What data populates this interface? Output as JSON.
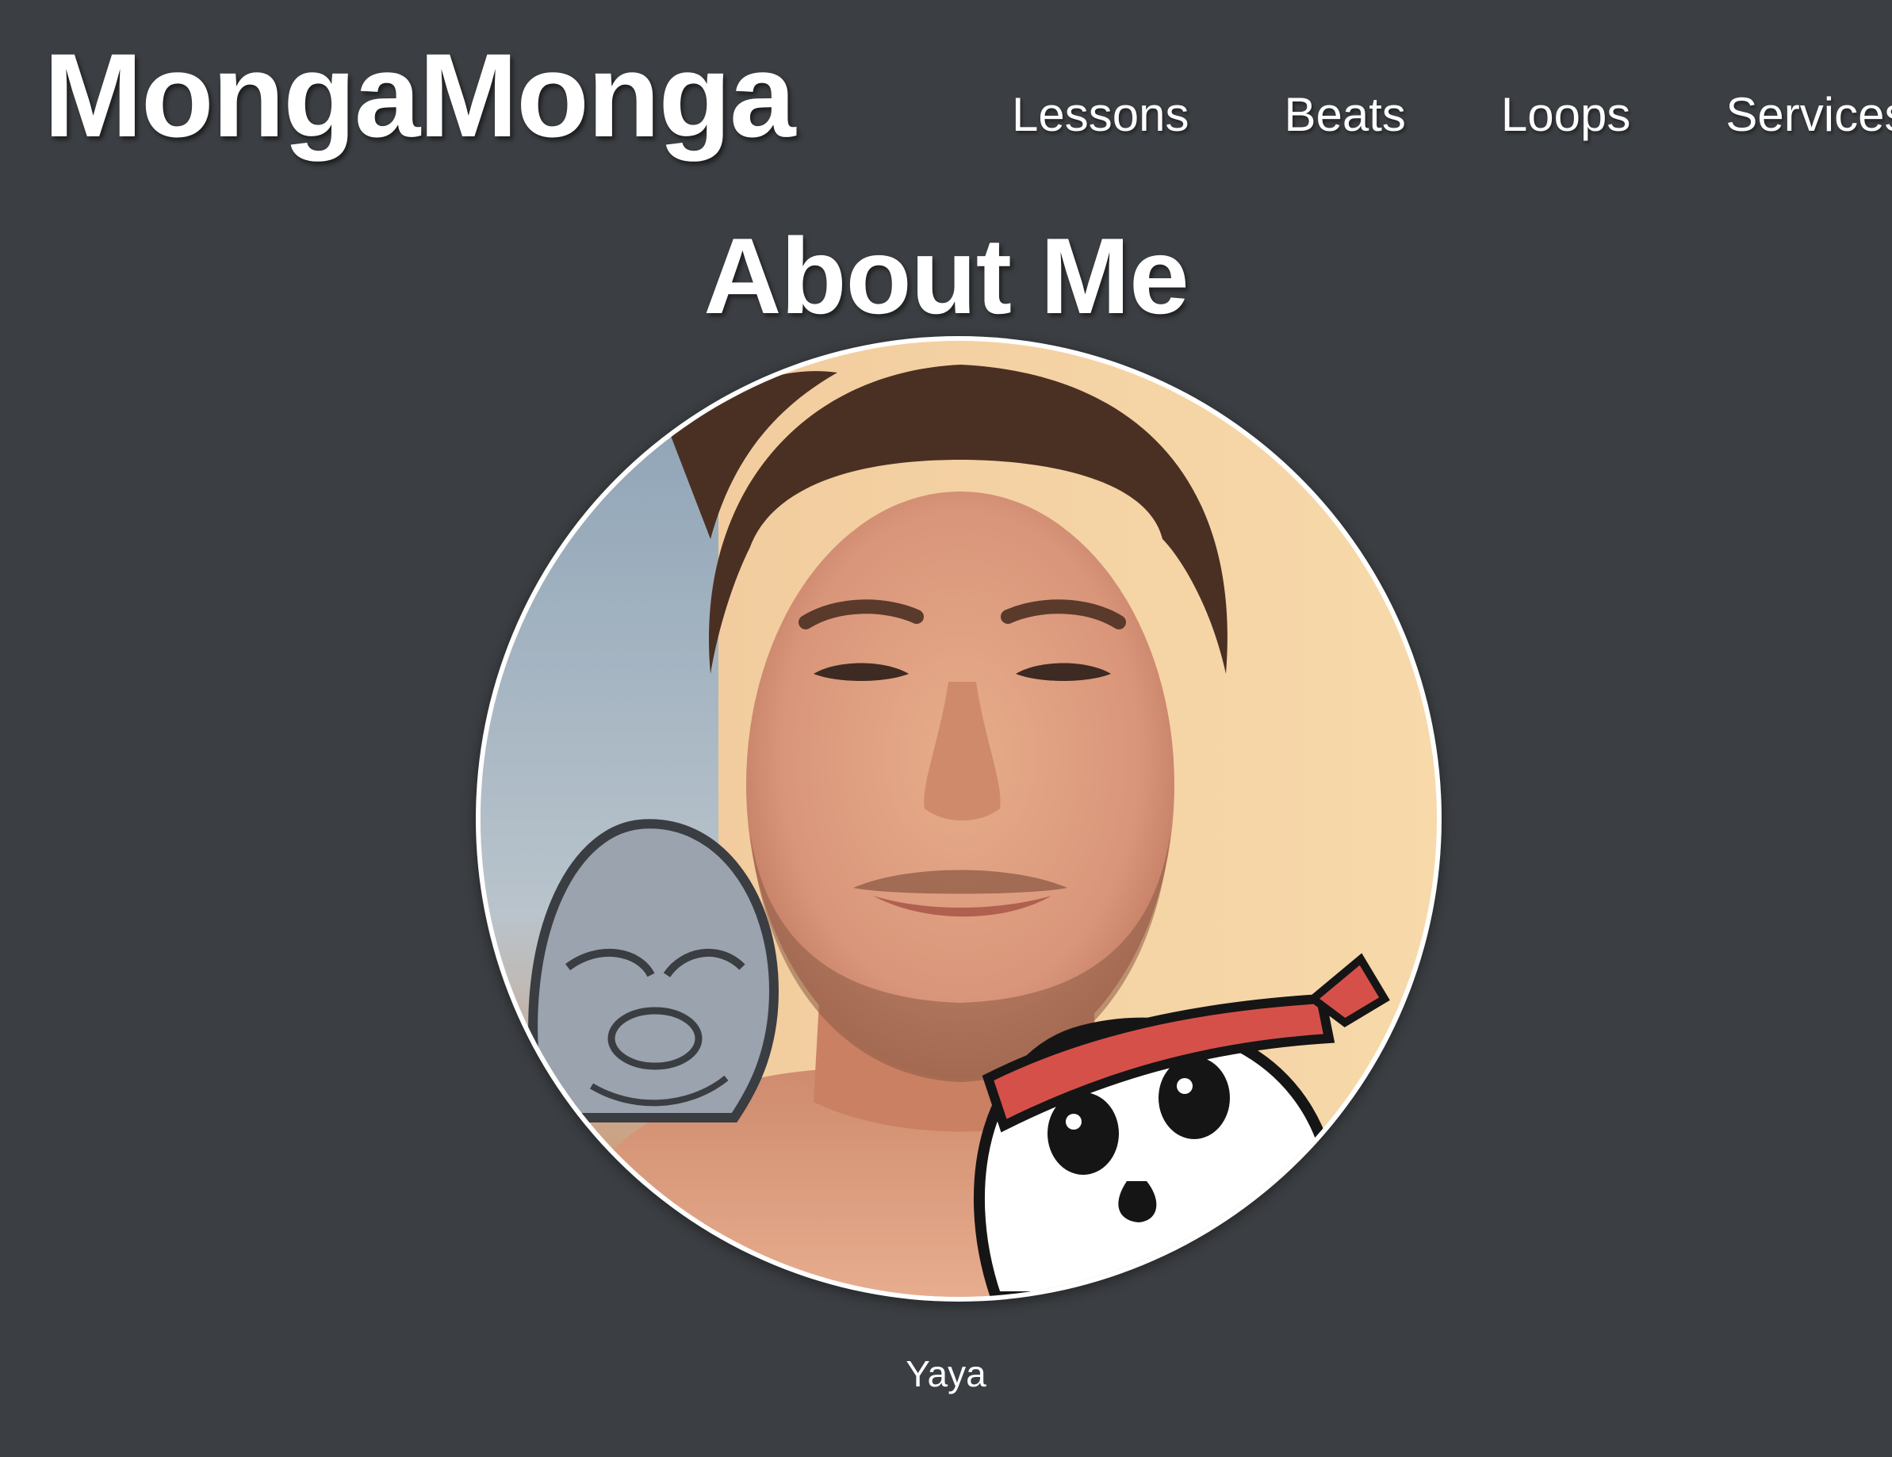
{
  "site": {
    "brand": "MongaMonga"
  },
  "nav": {
    "items": [
      {
        "label": "Lessons"
      },
      {
        "label": "Beats"
      },
      {
        "label": "Loops"
      },
      {
        "label": "Services"
      }
    ]
  },
  "main": {
    "title": "About Me",
    "caption": "Yaya"
  },
  "colors": {
    "background": "#3b3e42",
    "text": "#ffffff",
    "headband": "#d6504a"
  },
  "icons": {
    "avatar": "profile-photo",
    "gorilla": "gorilla-mascot-icon",
    "skull": "skull-mascot-icon"
  }
}
